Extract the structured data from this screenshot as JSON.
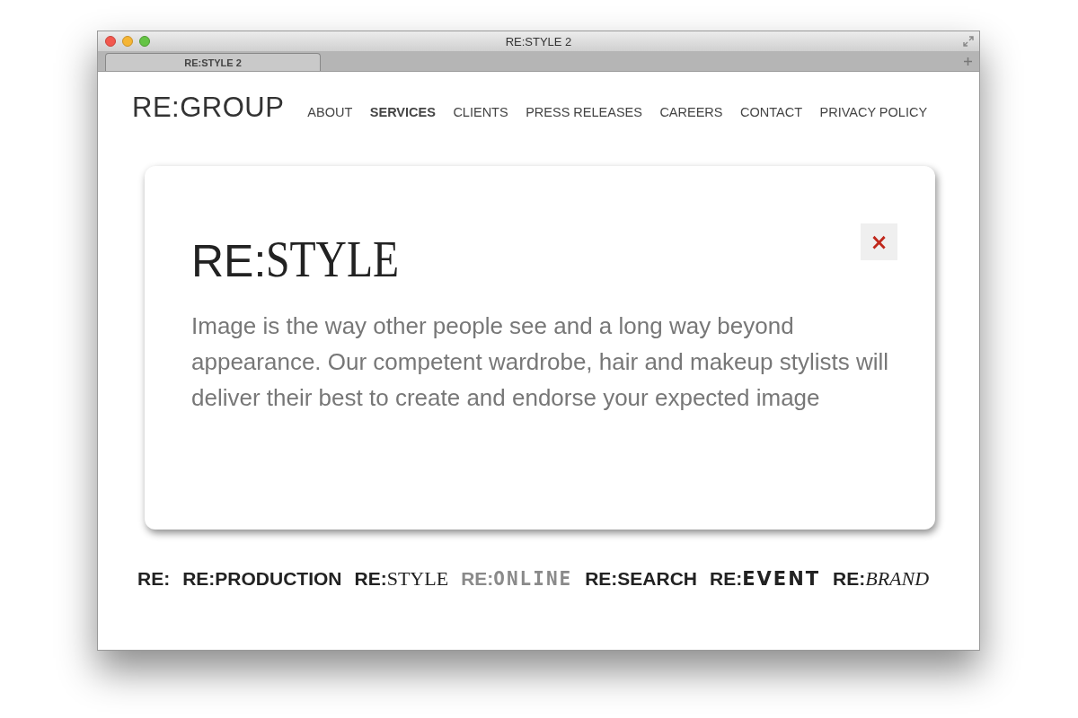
{
  "window": {
    "title": "RE:STYLE 2"
  },
  "tabs": [
    {
      "label": "RE:STYLE 2",
      "selected": true
    }
  ],
  "logo": "RE:GROUP",
  "nav": [
    {
      "label": "ABOUT",
      "selected": false
    },
    {
      "label": "SERVICES",
      "selected": true
    },
    {
      "label": "CLIENTS",
      "selected": false
    },
    {
      "label": "PRESS RELEASES",
      "selected": false
    },
    {
      "label": "CAREERS",
      "selected": false
    },
    {
      "label": "CONTACT",
      "selected": false
    },
    {
      "label": "PRIVACY POLICY",
      "selected": false
    }
  ],
  "card": {
    "title_prefix": "RE:",
    "title_name": "STYLE",
    "close": "×",
    "text": "Image is the way other people see and a long way beyond appearance. Our competent wardrobe, hair and makeup stylists will deliver their best to create and endorse your expected image"
  },
  "brands": [
    {
      "prefix": "RE:",
      "kind": "sans",
      "selected": false
    },
    {
      "prefix": "RE:",
      "name": "PRODUCTION",
      "kind": "sans",
      "selected": false
    },
    {
      "prefix": "RE:",
      "name": "STYLE",
      "kind": "serif",
      "selected": false
    },
    {
      "prefix": "RE:",
      "name": "ONLINE",
      "kind": "pixel",
      "selected": true
    },
    {
      "prefix": "RE:",
      "name": "SEARCH",
      "kind": "sans",
      "selected": false
    },
    {
      "prefix": "RE:",
      "name": "EVENT",
      "kind": "heavy",
      "selected": false
    },
    {
      "prefix": "RE:",
      "name": "BRAND",
      "kind": "italic",
      "selected": false
    }
  ]
}
